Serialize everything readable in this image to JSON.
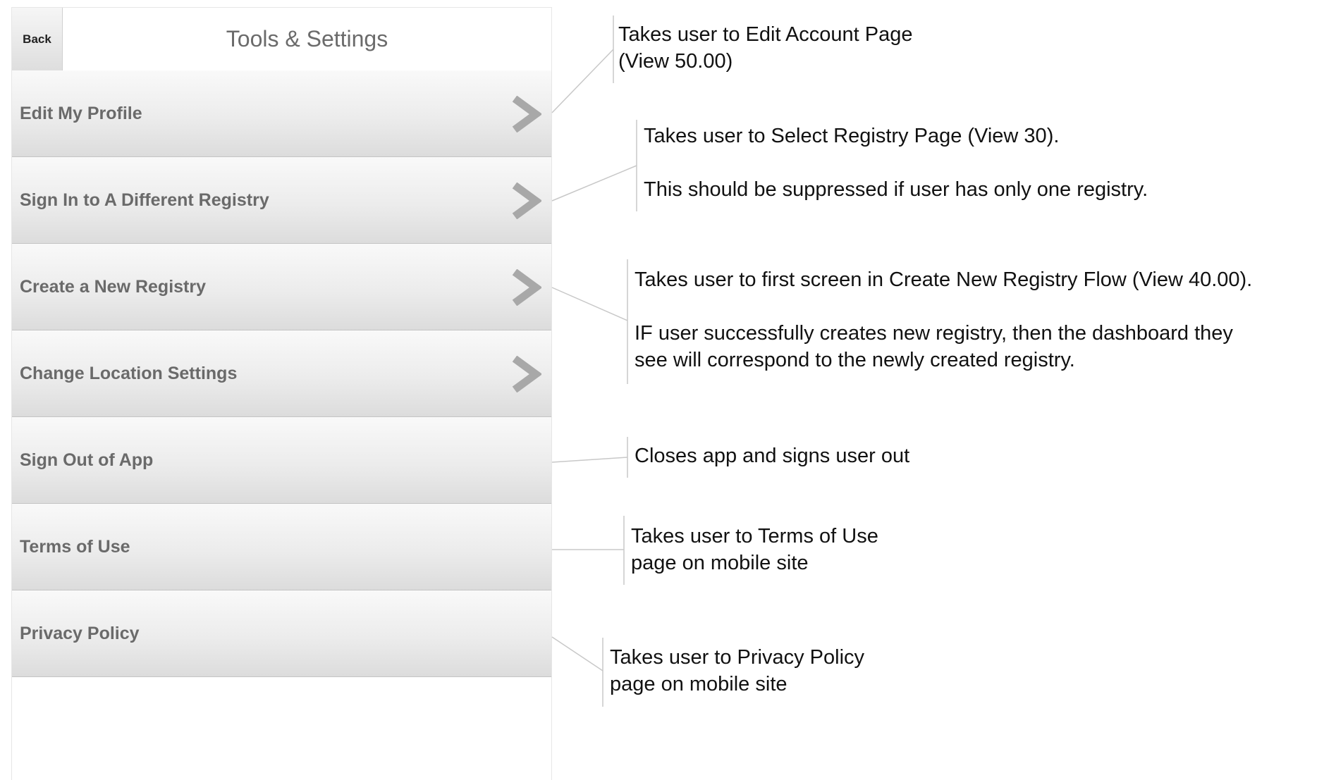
{
  "header": {
    "back_label": "Back",
    "title": "Tools & Settings"
  },
  "menu": {
    "items": [
      {
        "label": "Edit My Profile",
        "has_chevron": true
      },
      {
        "label": "Sign In to A Different Registry",
        "has_chevron": true
      },
      {
        "label": "Create a New Registry",
        "has_chevron": true
      },
      {
        "label": "Change Location Settings",
        "has_chevron": true
      },
      {
        "label": "Sign Out of App",
        "has_chevron": false
      },
      {
        "label": "Terms of Use",
        "has_chevron": false
      },
      {
        "label": "Privacy Policy",
        "has_chevron": false
      }
    ]
  },
  "annotations": {
    "edit_profile": {
      "line1": "Takes user to Edit Account Page",
      "line2": "(View 50.00)"
    },
    "different_registry": {
      "line1": "Takes user to Select Registry Page (View 30).",
      "line2": "This should be suppressed if user has only one registry."
    },
    "new_registry": {
      "line1": "Takes user to first screen in Create New Registry Flow (View 40.00).",
      "line2": "IF user successfully creates new registry, then the dashboard they",
      "line3": "see will correspond to the newly created registry."
    },
    "sign_out": {
      "line1": "Closes app and signs user out"
    },
    "terms": {
      "line1": "Takes user to Terms of Use",
      "line2": "page on mobile site"
    },
    "privacy": {
      "line1": "Takes user to Privacy Policy",
      "line2": "page on mobile site"
    }
  },
  "colors": {
    "chevron": "#a8a8a8",
    "menu_text": "#6a6a6a",
    "title_text": "#6b6b6b",
    "annotation_line": "#c8c8c8"
  },
  "icons": {
    "chevron": "chevron-right-icon"
  }
}
